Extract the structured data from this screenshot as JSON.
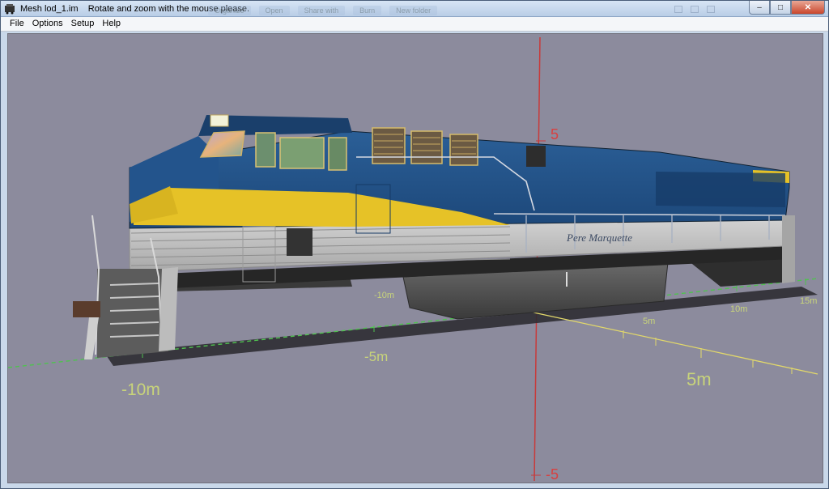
{
  "window": {
    "title": "Mesh lod_1.im    Rotate and zoom with the mouse please.",
    "background_toolbar": [
      "Organize",
      "Open",
      "Share with",
      "Burn",
      "New folder"
    ],
    "controls": {
      "minimize": "–",
      "maximize": "□",
      "close": "✕"
    }
  },
  "menu": {
    "items": [
      "File",
      "Options",
      "Setup",
      "Help"
    ]
  },
  "viewport": {
    "background": "#8c8b9d",
    "axis_labels": {
      "y_top": "5",
      "y_bottom": "-5",
      "x_pos": "5m",
      "x_neg": "-10m",
      "z_neg5": "-5m",
      "z_pos5": "5m",
      "z_neg10": "-10m",
      "z_10": "10m",
      "z_15": "15m"
    },
    "locomotive": {
      "livery_text": "Pere Marquette",
      "colors": {
        "blue": "#1f4f86",
        "yellow": "#e8c42a",
        "silver": "#bfbfbf",
        "fuel_tank": "#4d4d4d"
      }
    }
  }
}
